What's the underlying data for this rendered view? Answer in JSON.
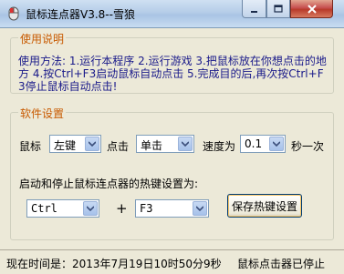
{
  "window": {
    "title": "鼠标连点器V3.8--雪狼"
  },
  "usage": {
    "title": "使用说明",
    "text": "使用方法: 1.运行本程序 2.运行游戏 3.把鼠标放在你想点击的地方 4.按Ctrl+F3启动鼠标自动点击 5.完成目的后,再次按Ctrl+F3停止鼠标自动点击!"
  },
  "settings": {
    "title": "软件设置",
    "mouse_label": "鼠标",
    "mouse_button": "左键",
    "click_label": "点击",
    "click_mode": "单击",
    "speed_label": "速度为",
    "speed_value": "0.1",
    "speed_unit": "秒一次",
    "hotkey_label": "启动和停止鼠标连点器的热键设置为:",
    "hotkey_modifier": "Ctrl",
    "plus": "+",
    "hotkey_key": "F3",
    "save_button": "保存热键设置"
  },
  "status": {
    "time": "现在时间是：2013年7月19日10时50分9秒",
    "state": "鼠标点击器已停止"
  },
  "colors": {
    "group_title": "#c85a00",
    "description_text": "#1a1a8a"
  }
}
